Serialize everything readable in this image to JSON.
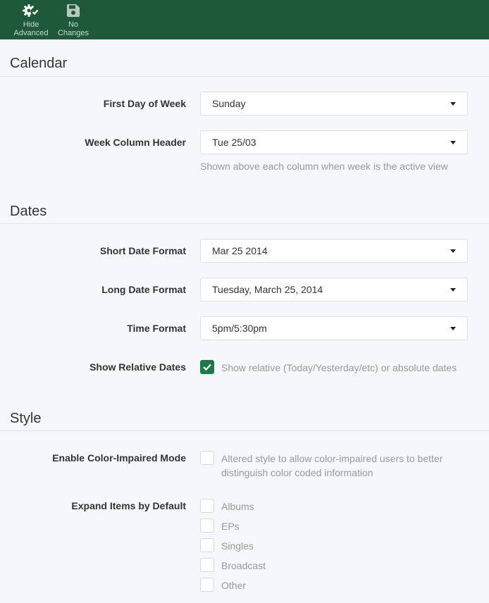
{
  "toolbar": {
    "advanced": {
      "line1": "Hide",
      "line2": "Advanced"
    },
    "changes": {
      "line1": "No",
      "line2": "Changes"
    }
  },
  "calendar": {
    "title": "Calendar",
    "first_day_label": "First Day of Week",
    "first_day_value": "Sunday",
    "week_header_label": "Week Column Header",
    "week_header_value": "Tue 25/03",
    "week_header_help": "Shown above each column when week is the active view"
  },
  "dates": {
    "title": "Dates",
    "short_label": "Short Date Format",
    "short_value": "Mar 25 2014",
    "long_label": "Long Date Format",
    "long_value": "Tuesday, March 25, 2014",
    "time_label": "Time Format",
    "time_value": "5pm/5:30pm",
    "relative_label": "Show Relative Dates",
    "relative_text": "Show relative (Today/Yesterday/etc) or absolute dates",
    "relative_checked": true
  },
  "style": {
    "title": "Style",
    "color_label": "Enable Color-Impaired Mode",
    "color_text_1": "Altered style to allow color-impaired users to better",
    "color_text_2": "distinguish color coded information",
    "color_checked": false,
    "expand_label": "Expand Items by Default",
    "expand_items": [
      "Albums",
      "EPs",
      "Singles",
      "Broadcast",
      "Other"
    ]
  },
  "colors": {
    "toolbar_bg": "#1e5a3a",
    "accent": "#1e7a44"
  }
}
